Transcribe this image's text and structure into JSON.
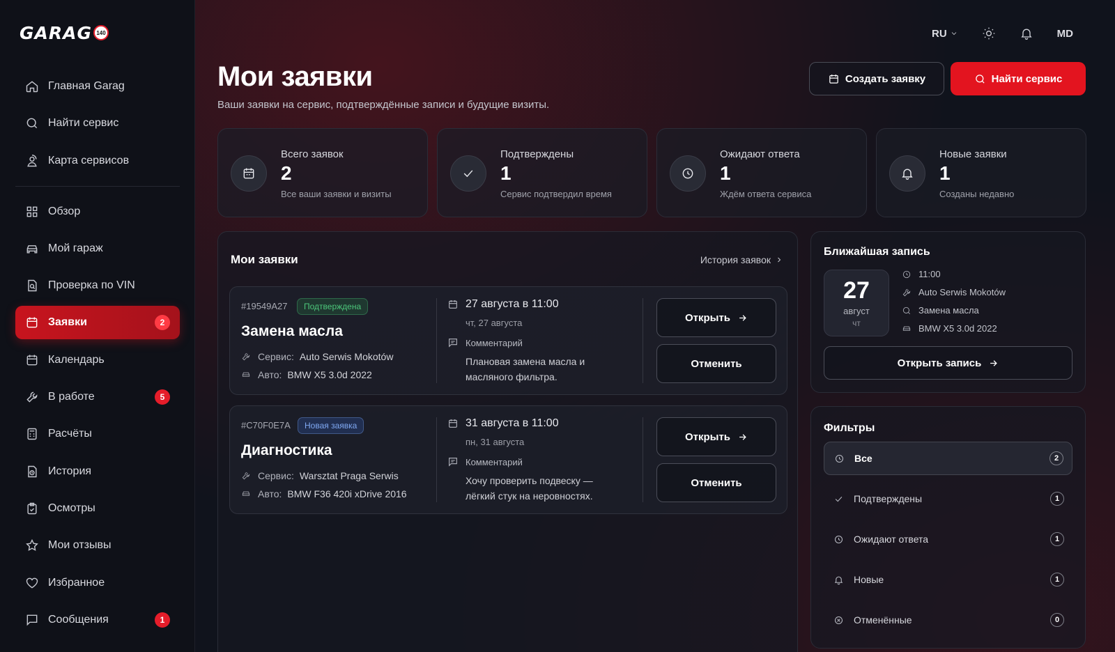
{
  "brand": {
    "logo_text": "GARAG",
    "logo_badge": "140"
  },
  "sidebar": {
    "group1": [
      {
        "label": "Главная Garag",
        "icon": "home-icon"
      },
      {
        "label": "Найти сервис",
        "icon": "search-icon"
      },
      {
        "label": "Карта сервисов",
        "icon": "map-pin-icon"
      }
    ],
    "group2": [
      {
        "label": "Обзор",
        "icon": "grid-icon"
      },
      {
        "label": "Мой гараж",
        "icon": "car-icon"
      },
      {
        "label": "Проверка по VIN",
        "icon": "document-search-icon"
      },
      {
        "label": "Заявки",
        "icon": "calendar-icon",
        "badge": "2",
        "active": true
      },
      {
        "label": "Календарь",
        "icon": "calendar-icon"
      },
      {
        "label": "В работе",
        "icon": "wrench-icon",
        "badge": "5"
      },
      {
        "label": "Расчёты",
        "icon": "calculator-icon"
      },
      {
        "label": "История",
        "icon": "history-icon"
      },
      {
        "label": "Осмотры",
        "icon": "clipboard-icon"
      },
      {
        "label": "Мои отзывы",
        "icon": "star-icon"
      },
      {
        "label": "Избранное",
        "icon": "heart-icon"
      },
      {
        "label": "Сообщения",
        "icon": "message-icon",
        "badge": "1"
      }
    ]
  },
  "topbar": {
    "lang": "RU",
    "user_initials": "MD"
  },
  "header": {
    "title": "Мои заявки",
    "subtitle": "Ваши заявки на сервис, подтверждённые записи и будущие визиты.",
    "create_label": "Создать заявку",
    "find_label": "Найти сервис"
  },
  "stats": [
    {
      "label": "Всего заявок",
      "value": "2",
      "desc": "Все ваши заявки и визиты",
      "icon": "calendar-icon"
    },
    {
      "label": "Подтверждены",
      "value": "1",
      "desc": "Сервис подтвердил время",
      "icon": "check-icon"
    },
    {
      "label": "Ожидают ответа",
      "value": "1",
      "desc": "Ждём ответа сервиса",
      "icon": "clock-icon"
    },
    {
      "label": "Новые заявки",
      "value": "1",
      "desc": "Созданы недавно",
      "icon": "bell-icon"
    }
  ],
  "requests_panel": {
    "title": "Мои заявки",
    "history_link": "История заявок",
    "items": [
      {
        "id": "#19549A27",
        "status": "Подтверждена",
        "status_color": "#4cc67a",
        "title": "Замена масла",
        "service_label": "Сервис:",
        "service": "Auto Serwis Mokotów",
        "car_label": "Авто:",
        "car": "BMW X5 3.0d 2022",
        "date": "27 августа в 11:00",
        "day": "чт, 27 августа",
        "comment_label": "Комментарий",
        "comment": "Плановая замена масла и масляного фильтра.",
        "open_label": "Открыть",
        "cancel_label": "Отменить"
      },
      {
        "id": "#C70F0E7A",
        "status": "Новая заявка",
        "status_color": "#7fa8f2",
        "title": "Диагностика",
        "service_label": "Сервис:",
        "service": "Warsztat Praga Serwis",
        "car_label": "Авто:",
        "car": "BMW F36 420i xDrive 2016",
        "date": "31 августа в 11:00",
        "day": "пн, 31 августа",
        "comment_label": "Комментарий",
        "comment": "Хочу проверить подвеску — лёгкий стук на неровностях.",
        "open_label": "Открыть",
        "cancel_label": "Отменить"
      }
    ]
  },
  "nearest": {
    "title": "Ближайшая запись",
    "day": "27",
    "month": "август",
    "weekday": "чт",
    "time": "11:00",
    "service": "Auto Serwis Mokotów",
    "job": "Замена масла",
    "car": "BMW X5 3.0d 2022",
    "open_label": "Открыть запись"
  },
  "filters": {
    "title": "Фильтры",
    "items": [
      {
        "label": "Все",
        "count": "2",
        "icon": "clock-icon",
        "active": true
      },
      {
        "label": "Подтверждены",
        "count": "1",
        "icon": "check-icon"
      },
      {
        "label": "Ожидают ответа",
        "count": "1",
        "icon": "clock-icon"
      },
      {
        "label": "Новые",
        "count": "1",
        "icon": "bell-icon"
      },
      {
        "label": "Отменённые",
        "count": "0",
        "icon": "x-circle-icon"
      }
    ]
  },
  "colors": {
    "accent": "#e3141f",
    "background": "#10131c",
    "sidebar": "#0f1118"
  }
}
